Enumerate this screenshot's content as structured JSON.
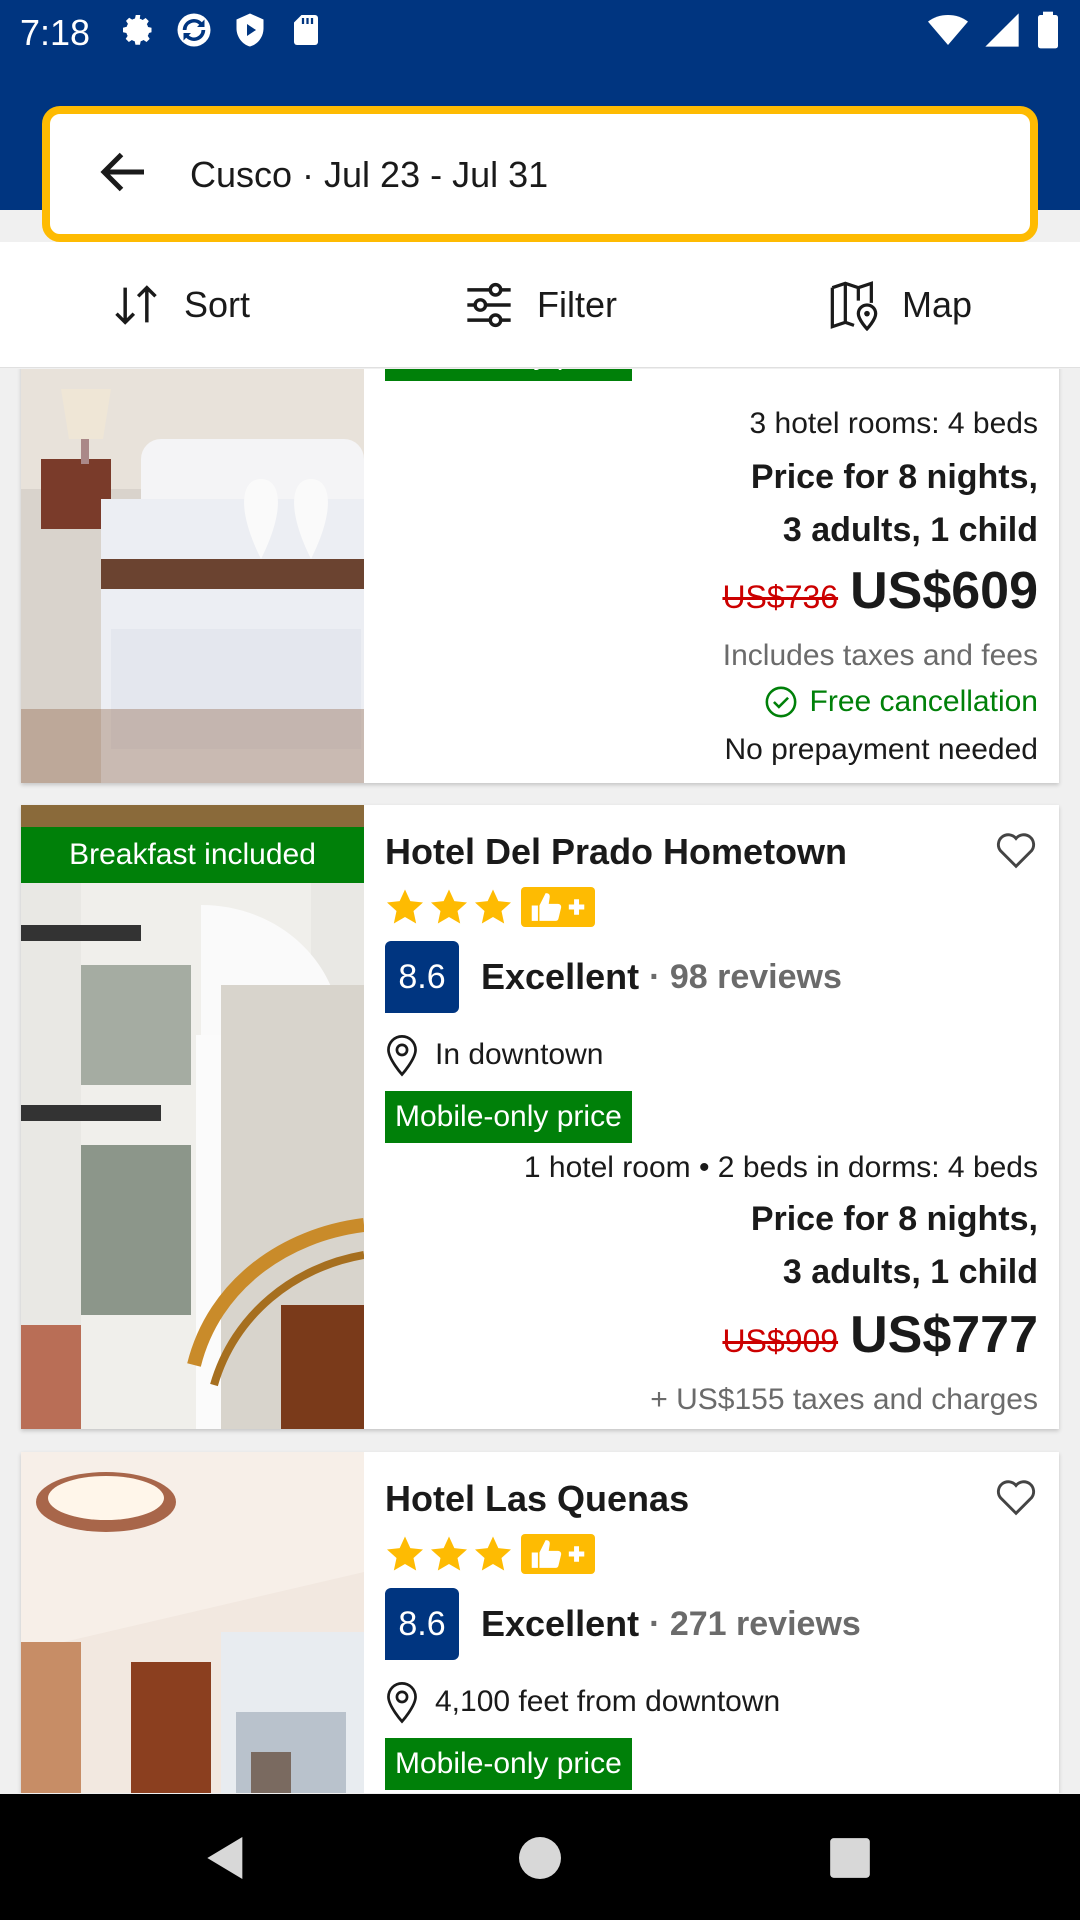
{
  "status_bar": {
    "time": "7:18"
  },
  "search": {
    "text": "Cusco · Jul 23 - Jul 31"
  },
  "toolbar": {
    "sort": "Sort",
    "filter": "Filter",
    "map": "Map"
  },
  "cards": [
    {
      "badge": "Mobile-only price",
      "rooms": "3 hotel rooms: 4 beds",
      "price_for_line1": "Price for 8 nights,",
      "price_for_line2": "3 adults, 1 child",
      "old_price": "US$736",
      "new_price": "US$609",
      "taxes": "Includes taxes and fees",
      "free_cancellation": "Free cancellation",
      "no_prepayment": "No prepayment needed"
    },
    {
      "photo_badge": "Breakfast included",
      "name": "Hotel Del Prado Hometown",
      "stars": 3,
      "score": "8.6",
      "score_word": "Excellent",
      "reviews": "· 98 reviews",
      "location": "In downtown",
      "badge": "Mobile-only price",
      "rooms": "1 hotel room • 2 beds in dorms: 4 beds",
      "price_for_line1": "Price for 8 nights,",
      "price_for_line2": "3 adults, 1 child",
      "old_price": "US$909",
      "new_price": "US$777",
      "taxes": "+ US$155 taxes and charges"
    },
    {
      "name": "Hotel Las Quenas",
      "stars": 3,
      "score": "8.6",
      "score_word": "Excellent",
      "reviews": "· 271 reviews",
      "location": "4,100 feet from downtown",
      "badge": "Mobile-only price"
    }
  ],
  "colors": {
    "brand_blue": "#003580",
    "search_border": "#febb02",
    "green": "#008009",
    "strike_red": "#cc0000"
  },
  "icons": [
    "settings-icon",
    "sync-icon",
    "shield-play-icon",
    "sd-card-icon",
    "wifi-icon",
    "signal-icon",
    "battery-icon",
    "back-arrow-icon",
    "sort-icon",
    "filter-icon",
    "map-icon",
    "heart-icon",
    "star-icon",
    "thumbs-up-plus-icon",
    "location-pin-icon",
    "check-circle-icon",
    "nav-back-icon",
    "nav-home-icon",
    "nav-recents-icon"
  ]
}
